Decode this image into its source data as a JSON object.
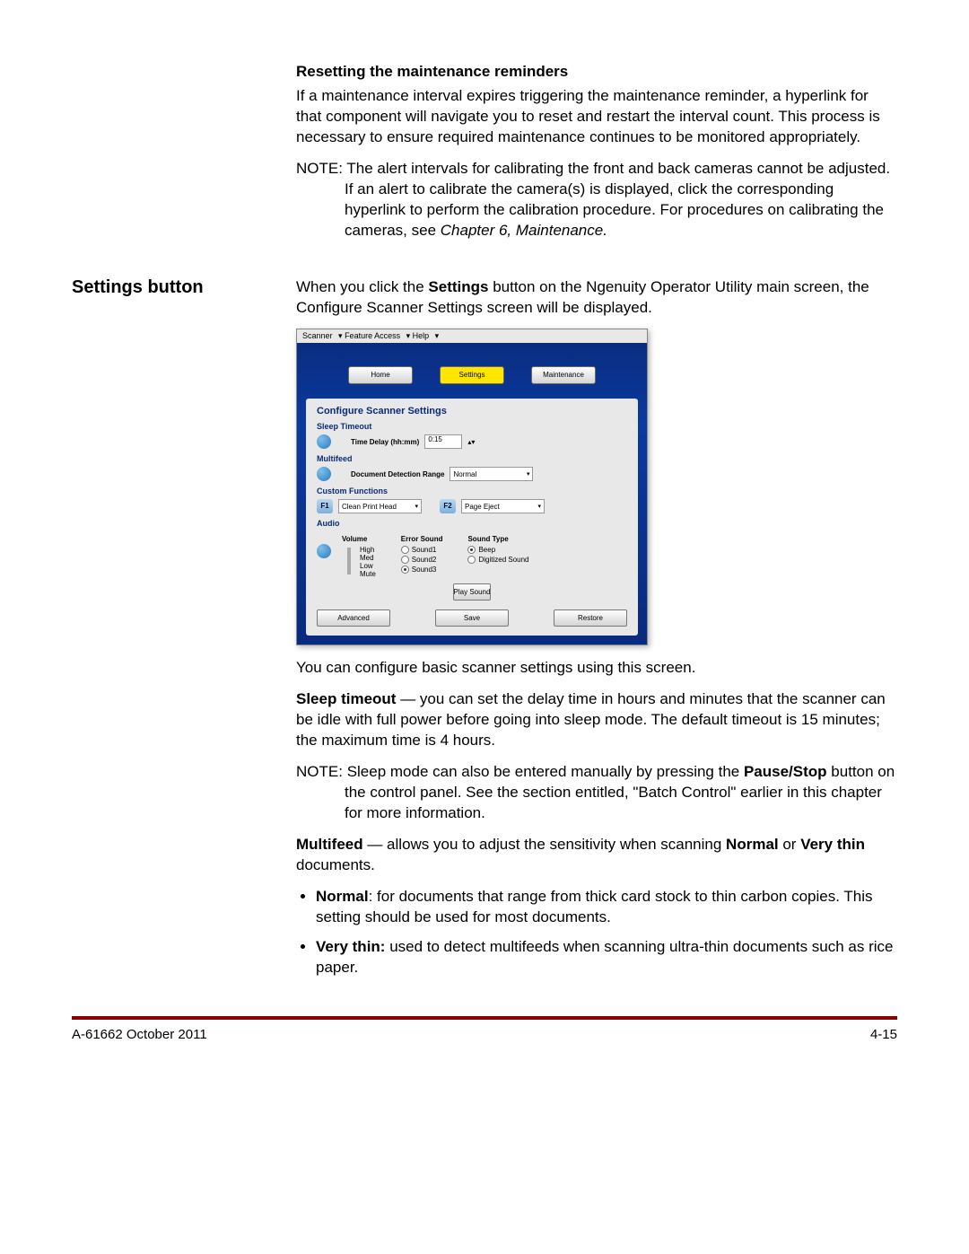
{
  "sections": {
    "reset_heading": "Resetting the maintenance reminders",
    "reset_para": "If a maintenance interval expires triggering the maintenance reminder, a hyperlink for that component will navigate you to reset and restart the interval count. This process is necessary to ensure required maintenance continues to be monitored appropriately.",
    "reset_note_label": "NOTE:",
    "reset_note_body": "The alert intervals for calibrating the front and back cameras cannot be adjusted. If an alert to calibrate the camera(s) is displayed, click the corresponding hyperlink to perform the calibration procedure. For procedures on calibrating the cameras, see ",
    "reset_note_ref": "Chapter 6, Maintenance.",
    "settings_side_heading": "Settings button",
    "settings_intro_1": "When you click the ",
    "settings_intro_bold": "Settings",
    "settings_intro_2": " button on the Ngenuity Operator Utility main screen, the Configure Scanner Settings screen will be displayed.",
    "after_screenshot": "You can configure basic scanner settings using this screen.",
    "sleep_bold": "Sleep timeout",
    "sleep_body": " — you can set the delay time in hours and minutes that the scanner can be idle with full power before going into sleep mode. The default timeout is 15 minutes; the maximum time is 4 hours.",
    "sleep_note_label": "NOTE:",
    "sleep_note_1": "Sleep mode can also be entered manually by pressing the ",
    "sleep_note_bold": "Pause/Stop",
    "sleep_note_2": " button on the control panel. See the section entitled, \"Batch Control\" earlier in this chapter for more information.",
    "multifeed_bold": "Multifeed",
    "multifeed_body_1": " — allows you to adjust the sensitivity when scanning ",
    "multifeed_bold2": "Normal",
    "multifeed_body_2": " or ",
    "multifeed_bold3": "Very thin",
    "multifeed_body_3": " documents.",
    "bullet1_bold": "Normal",
    "bullet1_body": ": for documents that range from thick card stock to thin carbon copies. This setting should be used for most documents.",
    "bullet2_bold": "Very thin:",
    "bullet2_body": " used to detect multifeeds when scanning ultra-thin documents such as rice paper."
  },
  "ui": {
    "menubar": {
      "scanner": "Scanner",
      "feature": "Feature Access",
      "help": "Help"
    },
    "tabs": {
      "home": "Home",
      "settings": "Settings",
      "maintenance": "Maintenance"
    },
    "panel_header": "Configure Scanner Settings",
    "sleep_section": "Sleep Timeout",
    "time_delay_label": "Time Delay (hh:mm)",
    "time_delay_value": "0:15",
    "multifeed_section": "Multifeed",
    "doc_detect_label": "Document Detection Range",
    "doc_detect_value": "Normal",
    "custom_section": "Custom Functions",
    "f1": "F1",
    "f1_value": "Clean Print Head",
    "f2": "F2",
    "f2_value": "Page Eject",
    "audio_section": "Audio",
    "volume_hdr": "Volume",
    "volume_high": "High",
    "volume_med": "Med",
    "volume_low": "Low",
    "volume_mute": "Mute",
    "error_hdr": "Error Sound",
    "sound1": "Sound1",
    "sound2": "Sound2",
    "sound3": "Sound3",
    "type_hdr": "Sound Type",
    "beep": "Beep",
    "digitized": "Digitized Sound",
    "play": "Play Sound",
    "advanced": "Advanced",
    "save": "Save",
    "restore": "Restore"
  },
  "footer": {
    "left": "A-61662   October 2011",
    "right": "4-15"
  }
}
